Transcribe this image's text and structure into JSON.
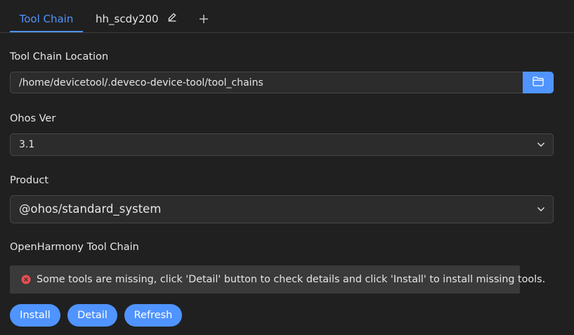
{
  "tabs": {
    "active_label": "Tool Chain",
    "second_label": "hh_scdy200",
    "add_label": "+"
  },
  "tool_chain_location": {
    "label": "Tool Chain Location",
    "value": "/home/devicetool/.deveco-device-tool/tool_chains",
    "browse_icon": "folder-icon"
  },
  "ohos_ver": {
    "label": "Ohos Ver",
    "value": "3.1"
  },
  "product": {
    "label": "Product",
    "value": "@ohos/standard_system"
  },
  "openharmony": {
    "label": "OpenHarmony Tool Chain",
    "alert_icon": "error-icon",
    "alert_message": "Some tools are missing, click 'Detail' button to check details and click 'Install' to install missing tools."
  },
  "actions": {
    "install": "Install",
    "detail": "Detail",
    "refresh": "Refresh"
  },
  "colors": {
    "accent": "#4f94ff",
    "background": "#202020",
    "error": "#e84d4d"
  }
}
